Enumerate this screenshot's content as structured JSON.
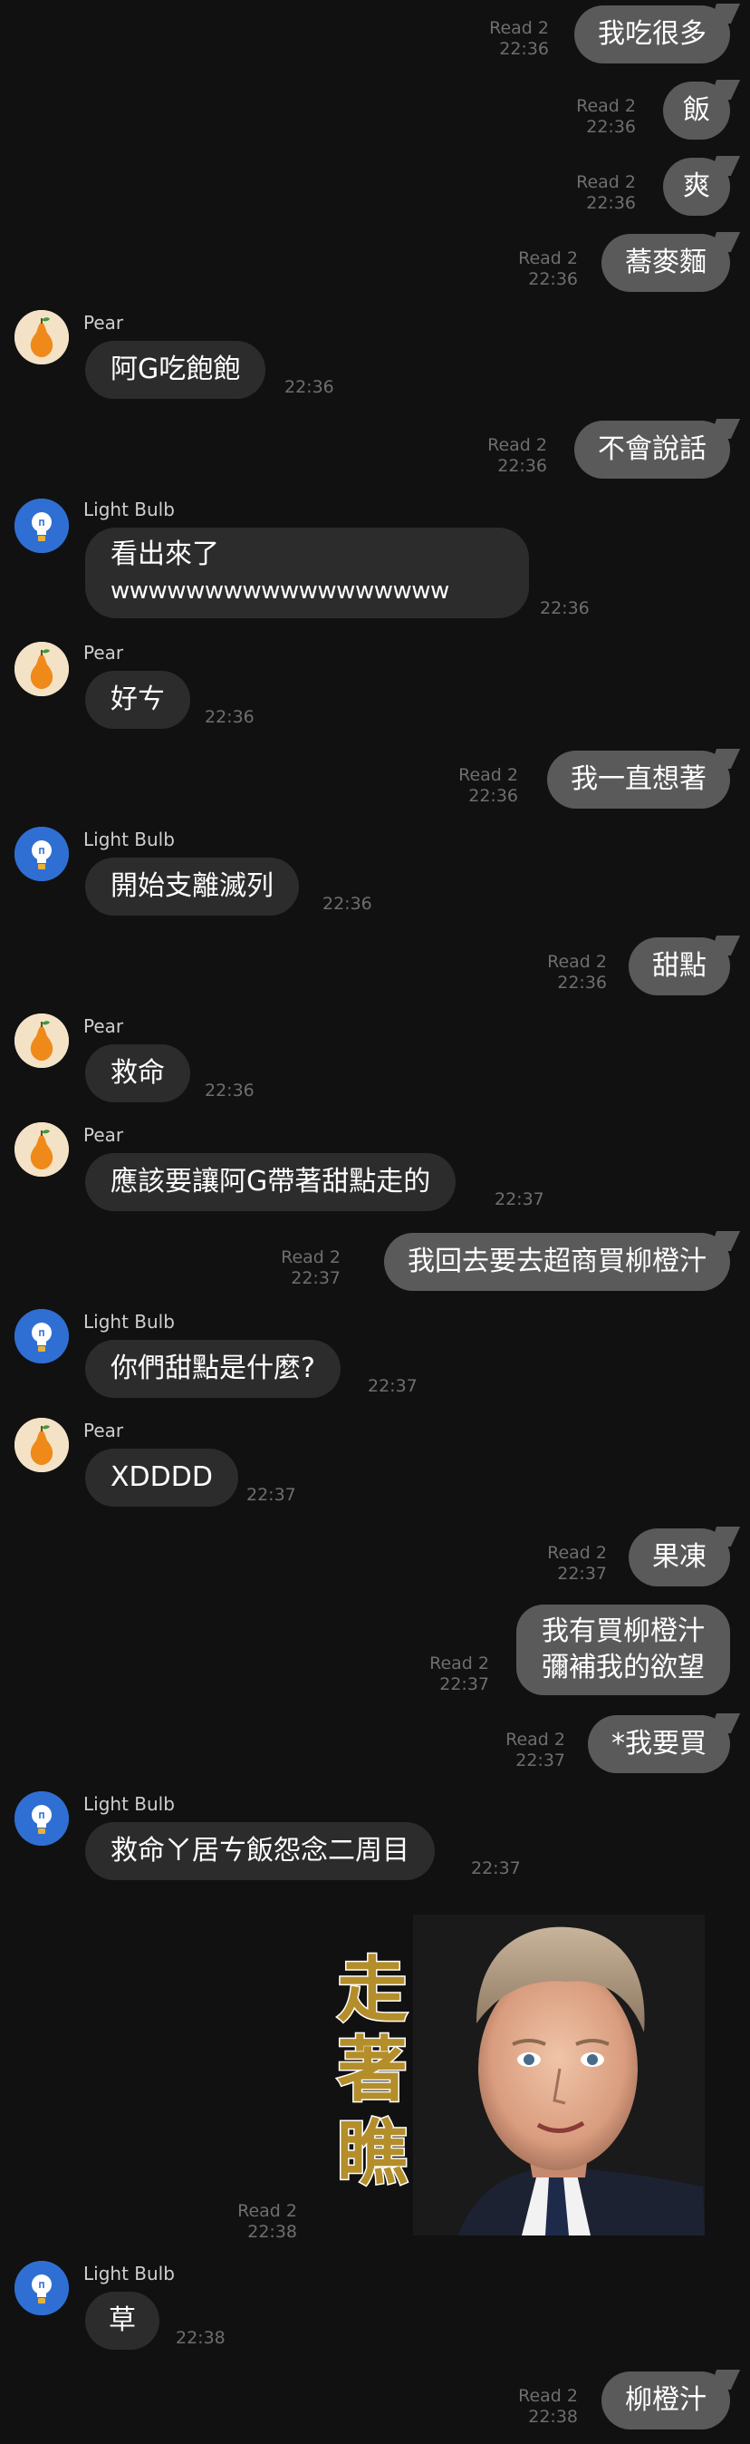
{
  "colors": {
    "background": "#111111",
    "outgoing_bubble": "#5a5a5a",
    "incoming_bubble": "#2c2c2c",
    "meta_text": "#6e6e6e",
    "pear_avatar": "#f4e2c7",
    "bulb_avatar": "#2f6fd3",
    "sticker_text": "#b48e2a"
  },
  "avatars": {
    "pear_icon": "pear-icon",
    "bulb_icon": "light-bulb-icon"
  },
  "messages": [
    {
      "dir": "out",
      "text": "我吃很多",
      "read": "Read 2",
      "time": "22:36"
    },
    {
      "dir": "out",
      "text": "飯",
      "read": "Read 2",
      "time": "22:36"
    },
    {
      "dir": "out",
      "text": "爽",
      "read": "Read 2",
      "time": "22:36"
    },
    {
      "dir": "out",
      "text": "蕎麥麵",
      "read": "Read 2",
      "time": "22:36"
    },
    {
      "dir": "in",
      "sender": "Pear",
      "text": "阿G吃飽飽",
      "time": "22:36"
    },
    {
      "dir": "out",
      "text": "不會說話",
      "read": "Read 2",
      "time": "22:36"
    },
    {
      "dir": "in",
      "sender": "Light Bulb",
      "text1": "看出來了",
      "text2": "wwwwwwwwwwwwwwwwww",
      "time": "22:36"
    },
    {
      "dir": "in",
      "sender": "Pear",
      "text": "好ㄘ",
      "time": "22:36"
    },
    {
      "dir": "out",
      "text": "我一直想著",
      "read": "Read 2",
      "time": "22:36"
    },
    {
      "dir": "in",
      "sender": "Light Bulb",
      "text": "開始支離滅列",
      "time": "22:36"
    },
    {
      "dir": "out",
      "text": "甜點",
      "read": "Read 2",
      "time": "22:36"
    },
    {
      "dir": "in",
      "sender": "Pear",
      "text": "救命",
      "time": "22:36"
    },
    {
      "dir": "in",
      "sender": "Pear",
      "text": "應該要讓阿G帶著甜點走的",
      "time": "22:37"
    },
    {
      "dir": "out",
      "text": "我回去要去超商買柳橙汁",
      "read": "Read 2",
      "time": "22:37"
    },
    {
      "dir": "in",
      "sender": "Light Bulb",
      "text": "你們甜點是什麼?",
      "time": "22:37"
    },
    {
      "dir": "in",
      "sender": "Pear",
      "text": "XDDDD",
      "time": "22:37"
    },
    {
      "dir": "out",
      "text": "果凍",
      "read": "Read 2",
      "time": "22:37"
    },
    {
      "dir": "out",
      "text1": "我有買柳橙汁",
      "text2": "彌補我的欲望",
      "read": "Read 2",
      "time": "22:37"
    },
    {
      "dir": "out",
      "text": "*我要買",
      "read": "Read 2",
      "time": "22:37"
    },
    {
      "dir": "in",
      "sender": "Light Bulb",
      "text": "救命ㄚ居ㄘ飯怨念二周目",
      "time": "22:37"
    },
    {
      "dir": "out-sticker",
      "sticker_text": [
        "走",
        "著",
        "瞧"
      ],
      "read": "Read 2",
      "time": "22:38"
    },
    {
      "dir": "in",
      "sender": "Light Bulb",
      "text": "草",
      "time": "22:38"
    },
    {
      "dir": "out",
      "text": "柳橙汁",
      "read": "Read 2",
      "time": "22:38"
    }
  ]
}
